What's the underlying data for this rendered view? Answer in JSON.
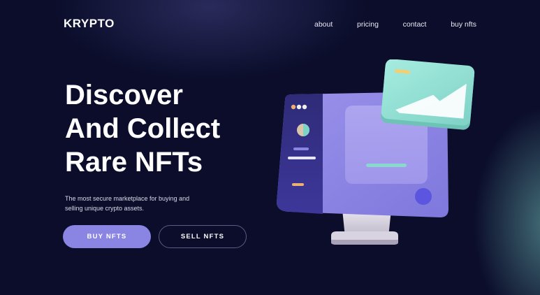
{
  "header": {
    "logo": "KRYPTO",
    "nav": [
      "about",
      "pricing",
      "contact",
      "buy nfts"
    ]
  },
  "hero": {
    "headline": [
      "Discover",
      "And Collect",
      "Rare NFTs"
    ],
    "subtitle": "The most secure marketplace for buying and selling unique crypto assets.",
    "buy_label": "BUY NFTS",
    "sell_label": "SELL  NFTS"
  },
  "colors": {
    "background": "#0b0d2b",
    "accent": "#8a85e3",
    "teal_glow": "#78c8be"
  },
  "icons": {
    "illustration": "computer-with-image-card"
  }
}
